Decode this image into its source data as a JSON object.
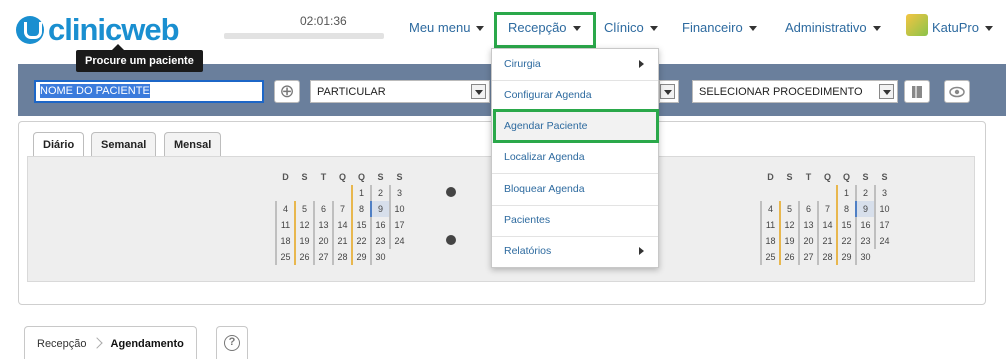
{
  "header": {
    "logo_text": "clinicweb",
    "tooltip": "Procure um paciente",
    "clock": "02:01:36",
    "nav": [
      {
        "label": "Meu menu"
      },
      {
        "label": "Recepção"
      },
      {
        "label": "Clínico"
      },
      {
        "label": "Financeiro"
      },
      {
        "label": "Administrativo"
      },
      {
        "label": "KatuPro"
      }
    ]
  },
  "searchbar": {
    "patient_value": "NOME DO PACIENTE",
    "convenio": "PARTICULAR",
    "procedimento": "SELECIONAR PROCEDIMENTO"
  },
  "calendar": {
    "tabs": [
      "Diário",
      "Semanal",
      "Mensal"
    ],
    "weekdays": [
      "D",
      "S",
      "T",
      "Q",
      "Q",
      "S",
      "S"
    ],
    "weeks": [
      [
        "",
        "",
        "",
        "",
        "1",
        "2",
        "3"
      ],
      [
        "4",
        "5",
        "6",
        "7",
        "8",
        "9",
        "10"
      ],
      [
        "11",
        "12",
        "13",
        "14",
        "15",
        "16",
        "17"
      ],
      [
        "18",
        "19",
        "20",
        "21",
        "22",
        "23",
        "24"
      ],
      [
        "25",
        "26",
        "27",
        "28",
        "29",
        "30",
        ""
      ]
    ],
    "today": "9"
  },
  "menu": {
    "items": [
      {
        "label": "Cirurgia",
        "submenu": true
      },
      {
        "label": "Configurar Agenda",
        "submenu": false
      },
      {
        "label": "Agendar Paciente",
        "submenu": false
      },
      {
        "label": "Localizar Agenda",
        "submenu": false
      },
      {
        "label": "Bloquear Agenda",
        "submenu": false
      },
      {
        "label": "Pacientes",
        "submenu": false
      },
      {
        "label": "Relatórios",
        "submenu": true
      }
    ]
  },
  "breadcrumb": {
    "parent": "Recepção",
    "current": "Agendamento",
    "help": "?"
  },
  "colors": {
    "brand": "#1a8fd0",
    "searchbar": "#6a7f9c",
    "highlight": "#2aa84a",
    "link": "#2d6a9f"
  }
}
